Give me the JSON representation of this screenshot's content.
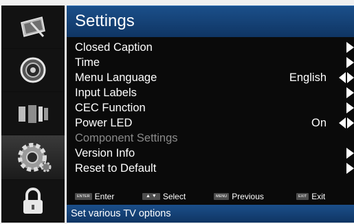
{
  "sidebar": {
    "items": [
      {
        "icon": "picture-icon"
      },
      {
        "icon": "sound-icon"
      },
      {
        "icon": "channel-icon"
      },
      {
        "icon": "gear-icon",
        "active": true
      },
      {
        "icon": "lock-icon"
      }
    ]
  },
  "header": {
    "title": "Settings"
  },
  "menu": {
    "items": [
      {
        "label": "Closed Caption",
        "value": "",
        "arrow": "right"
      },
      {
        "label": "Time",
        "value": "",
        "arrow": "right"
      },
      {
        "label": "Menu Language",
        "value": "English",
        "arrow": "both"
      },
      {
        "label": "Input Labels",
        "value": "",
        "arrow": "right"
      },
      {
        "label": "CEC Function",
        "value": "",
        "arrow": "right"
      },
      {
        "label": "Power LED",
        "value": "On",
        "arrow": "both"
      },
      {
        "label": "Component Settings",
        "value": "",
        "arrow": "none",
        "disabled": true
      },
      {
        "label": "Version Info",
        "value": "",
        "arrow": "right"
      },
      {
        "label": "Reset to Default",
        "value": "",
        "arrow": "right"
      }
    ]
  },
  "hints": {
    "enter": {
      "key": "ENTER",
      "label": "Enter"
    },
    "select": {
      "key": "▲ ▼",
      "label": "Select"
    },
    "previous": {
      "key": "MENU",
      "label": "Previous"
    },
    "exit": {
      "key": "EXIT",
      "label": "Exit"
    }
  },
  "status": {
    "text": "Set various TV options"
  },
  "colors": {
    "accent": "#1b4f8a",
    "background": "#0a0a0a",
    "text": "#ffffff",
    "disabled": "#8a8a8a"
  }
}
